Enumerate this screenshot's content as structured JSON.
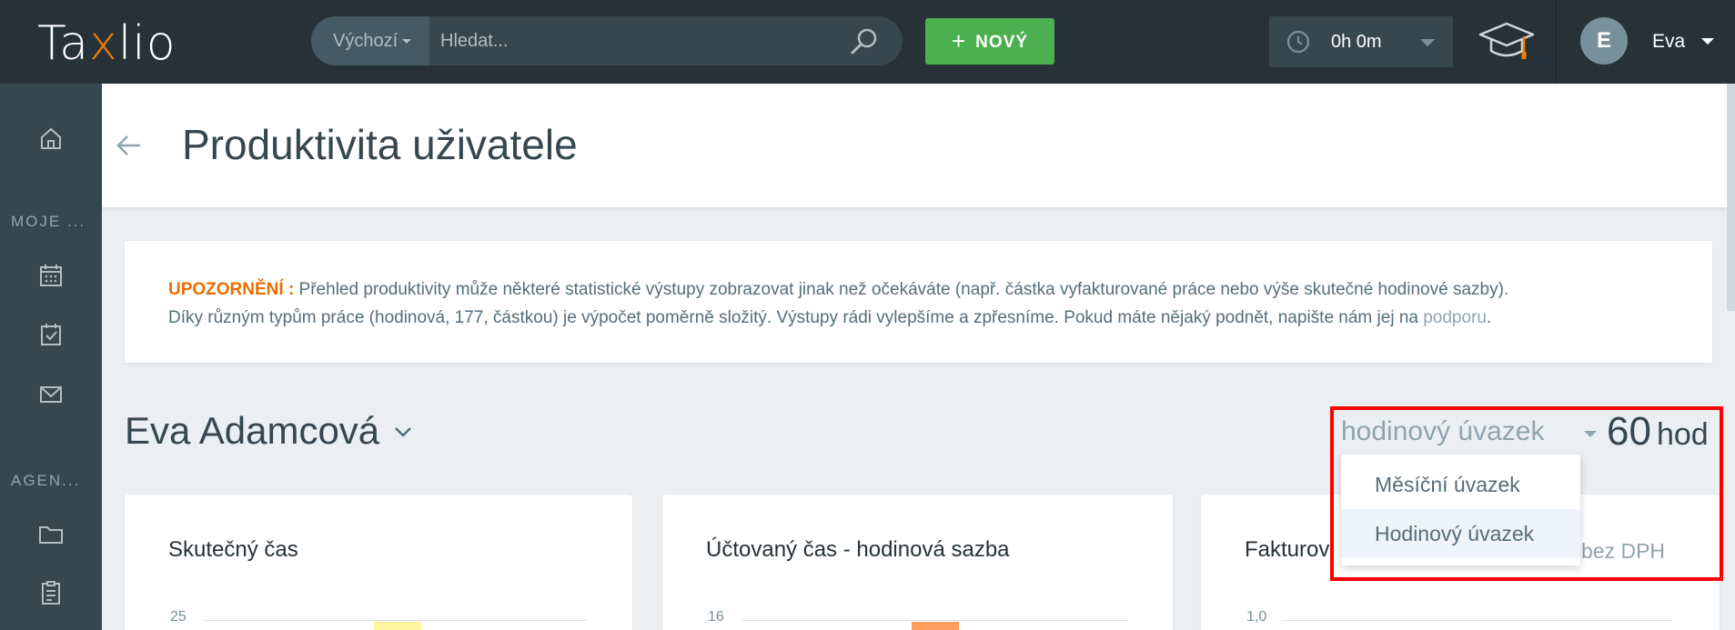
{
  "app": {
    "logo_prefix": "Ta",
    "logo_x": "x",
    "logo_suffix": "lio"
  },
  "search": {
    "scope": "Výchozí",
    "placeholder": "Hledat..."
  },
  "toolbar": {
    "new_label": "NOVÝ",
    "plus": "+"
  },
  "timer": {
    "value": "0h 0m"
  },
  "user": {
    "initial": "E",
    "name": "Eva"
  },
  "sidebar": {
    "sections": [
      {
        "label": "MOJE ..."
      },
      {
        "label": "AGEN..."
      }
    ],
    "icons": [
      "home-icon",
      "calendar-icon",
      "tasks-icon",
      "mail-icon",
      "folder-icon",
      "clipboard-icon"
    ]
  },
  "page": {
    "title": "Produktivita uživatele"
  },
  "notice": {
    "warn_label": "UPOZORNĚNÍ :",
    "line1": " Přehled produktivity může některé statistické výstupy zobrazovat jinak než očekáváte (např. částka vyfakturované práce nebo výše skutečné hodinové sazby).",
    "line2": "Díky různým typům práce (hodinová, 177, částkou) je výpočet poměrně složitý. Výstupy rádi vylepšíme a zpřesníme. Pokud máte nějaký podnět, napište nám jej na ",
    "link": "podporu",
    "end": "."
  },
  "person": {
    "name": "Eva Adamcová"
  },
  "contract": {
    "selected": "hodinový úvazek",
    "hours_value": "60",
    "hours_unit": "hod",
    "options": [
      "Měsíční úvazek",
      "Hodinový úvazek"
    ],
    "active_index": 1
  },
  "cards": [
    {
      "title": "Skutečný čas",
      "tick": "25",
      "bar_color": "#fff59d"
    },
    {
      "title": "Účtovaný čas - hodinová sazba",
      "tick": "16",
      "bar_color": "#ff9e5e"
    },
    {
      "title": "Fakturov",
      "tick": "1,0",
      "suffix": "bez DPH"
    }
  ],
  "colors": {
    "topbar": "#263238",
    "sidebar": "#37474f",
    "accent_green": "#4caf50",
    "warning_orange": "#ef6c00",
    "highlight_red": "#ff0000"
  }
}
